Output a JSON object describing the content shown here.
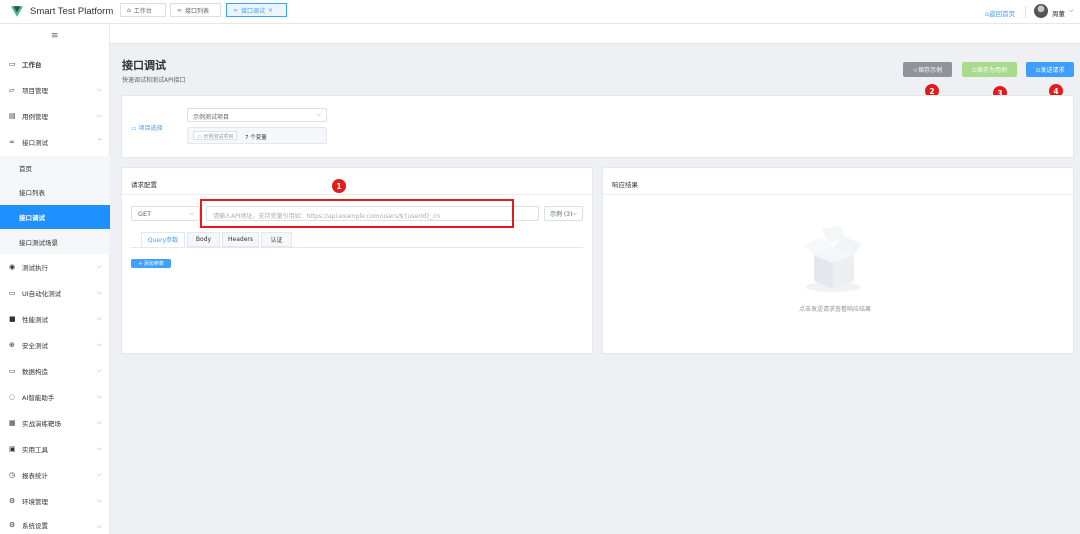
{
  "header": {
    "brand": "Smart Test Platform",
    "home_link": "⌂返回首页",
    "user_name": "周董",
    "colors": {
      "accent": "#409eff",
      "logo_green": "#41b883",
      "logo_dark": "#35495e"
    }
  },
  "sidebar": {
    "items": [
      {
        "label": "工作台",
        "icon": "monitor-icon"
      },
      {
        "label": "项目管理",
        "icon": "folder-icon"
      },
      {
        "label": "用例管理",
        "icon": "document-icon"
      },
      {
        "label": "接口测试",
        "icon": "link-icon"
      },
      {
        "label": "首页"
      },
      {
        "label": "接口列表"
      },
      {
        "label": "接口调试",
        "active": true
      },
      {
        "label": "接口测试场景"
      },
      {
        "label": "测试执行",
        "icon": "play-icon"
      },
      {
        "label": "UI自动化测试",
        "icon": "monitor-icon"
      },
      {
        "label": "性能测试",
        "icon": "chart-icon"
      },
      {
        "label": "安全测试",
        "icon": "lock-icon"
      },
      {
        "label": "数据构造",
        "icon": "chat-icon"
      },
      {
        "label": "AI智能助手",
        "icon": "chat-icon"
      },
      {
        "label": "实战演练靶场",
        "icon": "grid-icon"
      },
      {
        "label": "实用工具",
        "icon": "toolbox-icon"
      },
      {
        "label": "报表统计",
        "icon": "clock-icon"
      },
      {
        "label": "环境管理",
        "icon": "gear-icon"
      },
      {
        "label": "系统设置",
        "icon": "gear-icon"
      }
    ]
  },
  "tabs": [
    {
      "label": "工作台",
      "icon": "home-icon"
    },
    {
      "label": "接口列表",
      "icon": "link-icon"
    },
    {
      "label": "接口调试",
      "icon": "link-icon",
      "close": "×",
      "active": true
    }
  ],
  "page": {
    "title": "接口调试",
    "subtitle": "快速调试和测试API接口",
    "buttons": {
      "save_example": "☆保存示例",
      "save_case": "⊙保存为用例",
      "send": "⊙发送请求"
    },
    "markers": [
      "1",
      "2",
      "3",
      "4"
    ]
  },
  "project": {
    "label": "项目选择",
    "selected": "示例测试项目",
    "tag": "示例测试项目",
    "var_count": "7 个变量"
  },
  "request": {
    "title": "请求配置",
    "method": "GET",
    "url_placeholder": "请输入API地址，支持变量引用如：https://api.example.com/users/${userId}_cn",
    "example_label": "示例 (3)",
    "subtabs": [
      "Query参数",
      "Body",
      "Headers",
      "认证"
    ],
    "add_param": "+ 添加参数"
  },
  "response": {
    "title": "响应结果",
    "empty_text": "点击发送请求查看响应结果"
  }
}
